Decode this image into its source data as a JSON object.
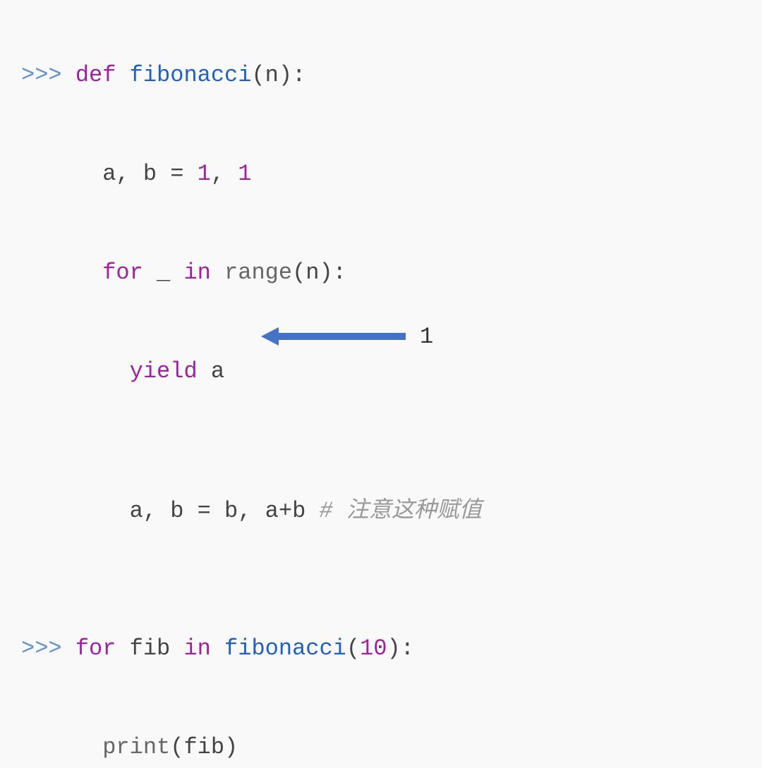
{
  "lines": {
    "l1": {
      "prompt": ">>> ",
      "def": "def",
      "space1": " ",
      "funcname": "fibonacci",
      "lparen": "(",
      "param": "n",
      "rparen": ")",
      "colon": ":"
    },
    "l2": {
      "indent": "      ",
      "a": "a",
      "comma1": ", ",
      "b": "b",
      "eq": " = ",
      "one1": "1",
      "comma2": ", ",
      "one2": "1"
    },
    "l3": {
      "indent": "      ",
      "for": "for",
      "space1": " ",
      "under": "_",
      "space2": " ",
      "in": "in",
      "space3": " ",
      "range": "range",
      "lparen": "(",
      "n": "n",
      "rparen": ")",
      "colon": ":"
    },
    "l4": {
      "indent": "        ",
      "yield": "yield",
      "space": " ",
      "a": "a"
    },
    "l5": {
      "indent": "        ",
      "a": "a",
      "comma1": ", ",
      "b": "b",
      "eq": " = ",
      "b2": "b",
      "comma2": ", ",
      "a2": "a",
      "plus": "+",
      "b3": "b",
      "space": " ",
      "comment": "# 注意这种赋值"
    },
    "l6": {
      "prompt": ">>> ",
      "for": "for",
      "space1": " ",
      "fib": "fib",
      "space2": " ",
      "in": "in",
      "space3": " ",
      "funcname": "fibonacci",
      "lparen": "(",
      "num": "10",
      "rparen": ")",
      "colon": ":"
    },
    "l7": {
      "indent": "      ",
      "print": "print",
      "lparen": "(",
      "fib": "fib",
      "rparen": ")"
    }
  },
  "annotation": {
    "label": "1"
  }
}
